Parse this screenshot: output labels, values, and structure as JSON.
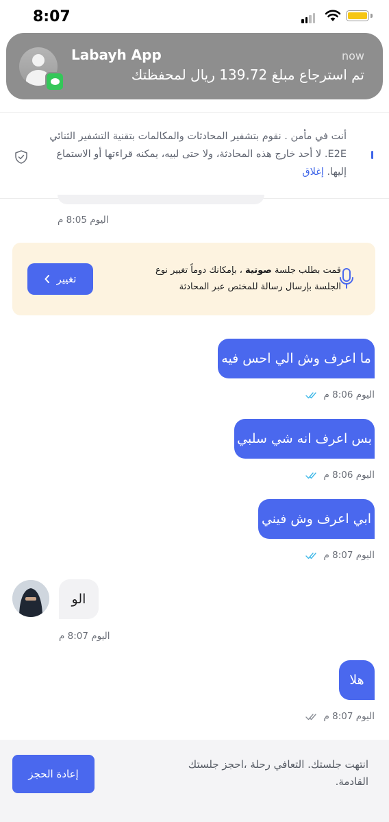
{
  "status_bar": {
    "time": "8:07"
  },
  "notification": {
    "app_name": "Labayh App",
    "time": "now",
    "message": "تم استرجاع مبلغ 139.72 ريال لمحفظتك"
  },
  "encryption_notice": {
    "text": "أنت في مأمن . نقوم بتشفير المحادثات والمكالمات بتقنية التشفير الثنائي E2E. لا أحد خارج هذه المحادثة، ولا حتى لبيه، يمكنه قراءتها أو الاستماع إليها.",
    "close_label": "إغلاق"
  },
  "previous_message_time": "اليوم 8:05 م",
  "voice_session": {
    "text_before": "قمت بطلب جلسة ",
    "text_bold": "صوتية",
    "text_after": " ، بإمكانك دوماً تغيير نوع الجلسة بإرسال رسالة للمختص عبر المحادثة",
    "button_label": "تغيير"
  },
  "messages": [
    {
      "text": "ما اعرف وش الي احس فيه",
      "time": "اليوم 8:06 م",
      "direction": "out",
      "status": "read"
    },
    {
      "text": "بس اعرف انه شي سلبي",
      "time": "اليوم 8:06 م",
      "direction": "out",
      "status": "read"
    },
    {
      "text": "ابي اعرف وش فيني",
      "time": "اليوم 8:07 م",
      "direction": "out",
      "status": "read"
    },
    {
      "text": "الو",
      "time": "اليوم 8:07 م",
      "direction": "in"
    },
    {
      "text": "هلا",
      "time": "اليوم 8:07 م",
      "direction": "out",
      "status": "delivered"
    }
  ],
  "footer": {
    "text": "انتهت جلستك. التعافي رحلة ،احجز جلستك القادمة.",
    "button_label": "إعادة الحجز"
  },
  "colors": {
    "accent": "#4a68ee",
    "read_tick": "#3fb8e8",
    "delivered_tick": "#8a8e96",
    "card_bg": "#fdf3e0"
  }
}
